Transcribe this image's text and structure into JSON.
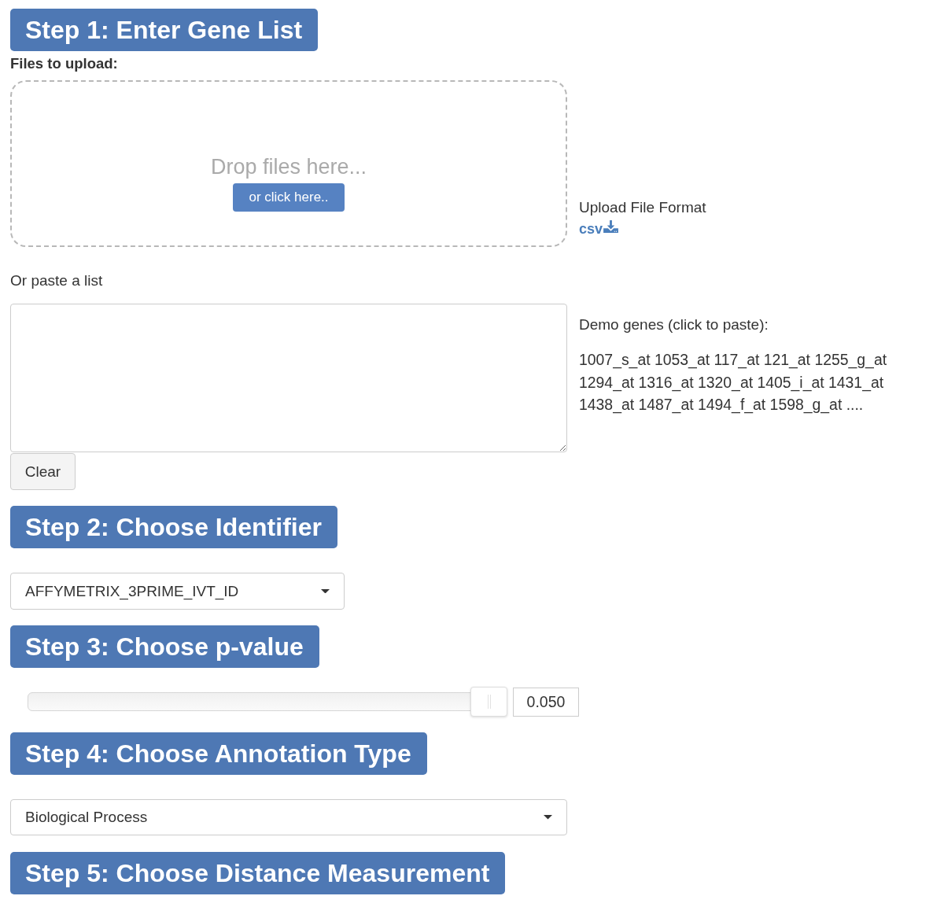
{
  "step_1": {
    "heading": "Step 1: Enter Gene List",
    "upload_label": "Files to upload:",
    "dropzone": {
      "prompt": "Drop files here...",
      "button": "or click here.."
    },
    "file_format": {
      "label": "Upload File Format",
      "link": "csv"
    },
    "paste_label": "Or paste a list",
    "demo": {
      "label": "Demo genes (click to paste):",
      "genes": "1007_s_at 1053_at 117_at 121_at 1255_g_at 1294_at 1316_at 1320_at 1405_i_at 1431_at 1438_at 1487_at 1494_f_at 1598_g_at ...."
    },
    "clear_button": "Clear"
  },
  "step_2": {
    "heading": "Step 2: Choose Identifier",
    "select": {
      "value": "AFFYMETRIX_3PRIME_IVT_ID"
    }
  },
  "step_3": {
    "heading": "Step 3: Choose p-value",
    "slider": {
      "level": 1,
      "value": "0.050"
    }
  },
  "step_4": {
    "heading": "Step 4: Choose Annotation Type",
    "select": {
      "value": "Biological Process"
    }
  },
  "step_5": {
    "heading": "Step 5: Choose Distance Measurement"
  }
}
